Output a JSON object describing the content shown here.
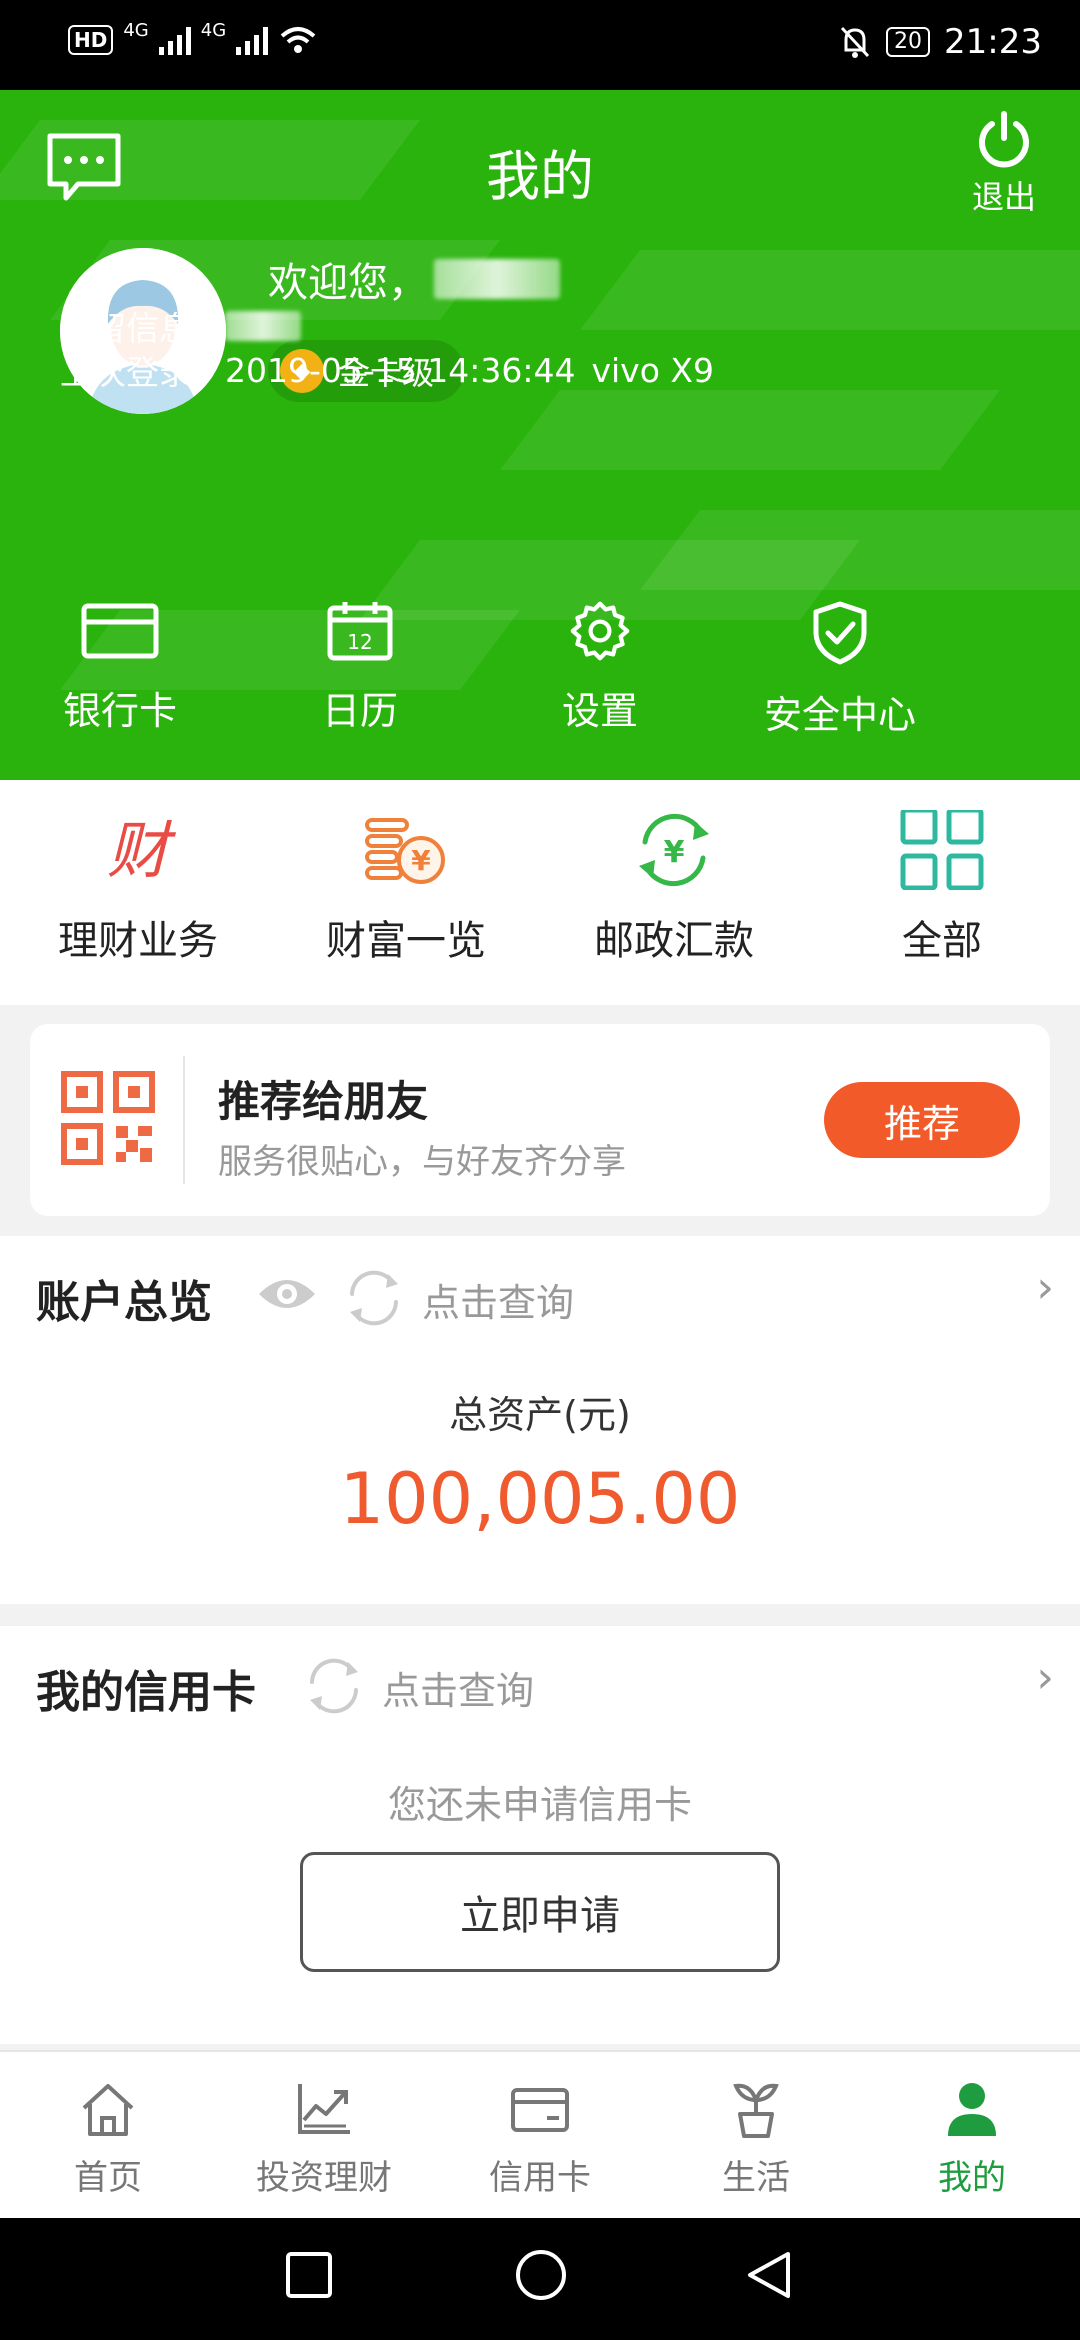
{
  "status_bar": {
    "hd": "HD",
    "net1": "4G",
    "net2": "4G",
    "battery": "20",
    "time": "21:23"
  },
  "header": {
    "title": "我的",
    "logout_label": "退出",
    "welcome": "欢迎您，",
    "level": "金卡级",
    "reserved_info_label": "预留信息：",
    "last_login_label": "上次登录：",
    "last_login_time": "2019-05-15 14:36:44",
    "last_login_device": "vivo X9",
    "shortcuts": [
      {
        "label": "银行卡",
        "icon": "bank-card-icon"
      },
      {
        "label": "日历",
        "icon": "calendar-icon"
      },
      {
        "label": "设置",
        "icon": "settings-gear-icon"
      },
      {
        "label": "安全中心",
        "icon": "shield-check-icon"
      }
    ],
    "calendar_day": "12",
    "bg_color": "#29b30c"
  },
  "services": [
    {
      "label": "理财业务",
      "icon": "wealth-icon",
      "glyph": "财"
    },
    {
      "label": "财富一览",
      "icon": "coins-yuan-icon",
      "glyph": "¥"
    },
    {
      "label": "邮政汇款",
      "icon": "remittance-yuan-icon",
      "glyph": "¥"
    },
    {
      "label": "全部",
      "icon": "grid-all-icon"
    }
  ],
  "recommend": {
    "title": "推荐给朋友",
    "subtitle": "服务很贴心，与好友齐分享",
    "button": "推荐",
    "button_color": "#f25a2a"
  },
  "account": {
    "title": "账户总览",
    "query": "点击查询",
    "total_label": "总资产(元)",
    "total_value": "100,005.00",
    "value_color": "#ef5a2e"
  },
  "credit": {
    "title": "我的信用卡",
    "query": "点击查询",
    "empty": "您还未申请信用卡",
    "apply": "立即申请"
  },
  "bottom_nav": [
    {
      "label": "首页",
      "icon": "home-icon",
      "active": false
    },
    {
      "label": "投资理财",
      "icon": "investment-chart-icon",
      "active": false
    },
    {
      "label": "信用卡",
      "icon": "credit-card-icon",
      "active": false
    },
    {
      "label": "生活",
      "icon": "plant-sprout-icon",
      "active": false
    },
    {
      "label": "我的",
      "icon": "user-icon",
      "active": true
    }
  ],
  "active_color": "#1f9c3f"
}
